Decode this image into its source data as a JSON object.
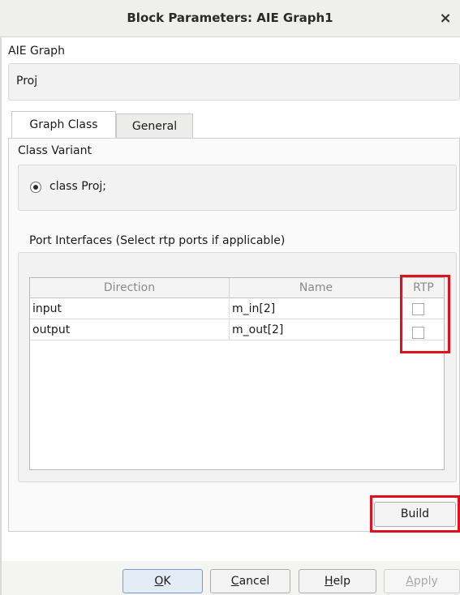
{
  "window": {
    "title": "Block Parameters: AIE Graph1",
    "close_glyph": "×"
  },
  "block": {
    "type_label": "AIE Graph",
    "description": "Proj"
  },
  "tabs": [
    {
      "label": "Graph Class"
    },
    {
      "label": "General"
    }
  ],
  "class_variant": {
    "label": "Class Variant",
    "selected_option": "class Proj;"
  },
  "port_interfaces": {
    "label": "Port Interfaces (Select rtp ports if applicable)",
    "columns": [
      "Direction",
      "Name",
      "RTP"
    ],
    "rows": [
      {
        "direction": "input",
        "name": "m_in[2]",
        "rtp": false
      },
      {
        "direction": "output",
        "name": "m_out[2]",
        "rtp": false
      }
    ]
  },
  "build_button": "Build",
  "buttons": {
    "ok": {
      "mnemonic": "O",
      "rest": "K"
    },
    "cancel": {
      "mnemonic": "C",
      "rest": "ancel"
    },
    "help": {
      "mnemonic": "H",
      "rest": "elp"
    },
    "apply": {
      "mnemonic": "A",
      "rest": "pply",
      "enabled": false
    }
  },
  "colors": {
    "highlight": "#e0101c",
    "panel_bg": "#f2f2f2",
    "title_bg": "#efefed"
  }
}
